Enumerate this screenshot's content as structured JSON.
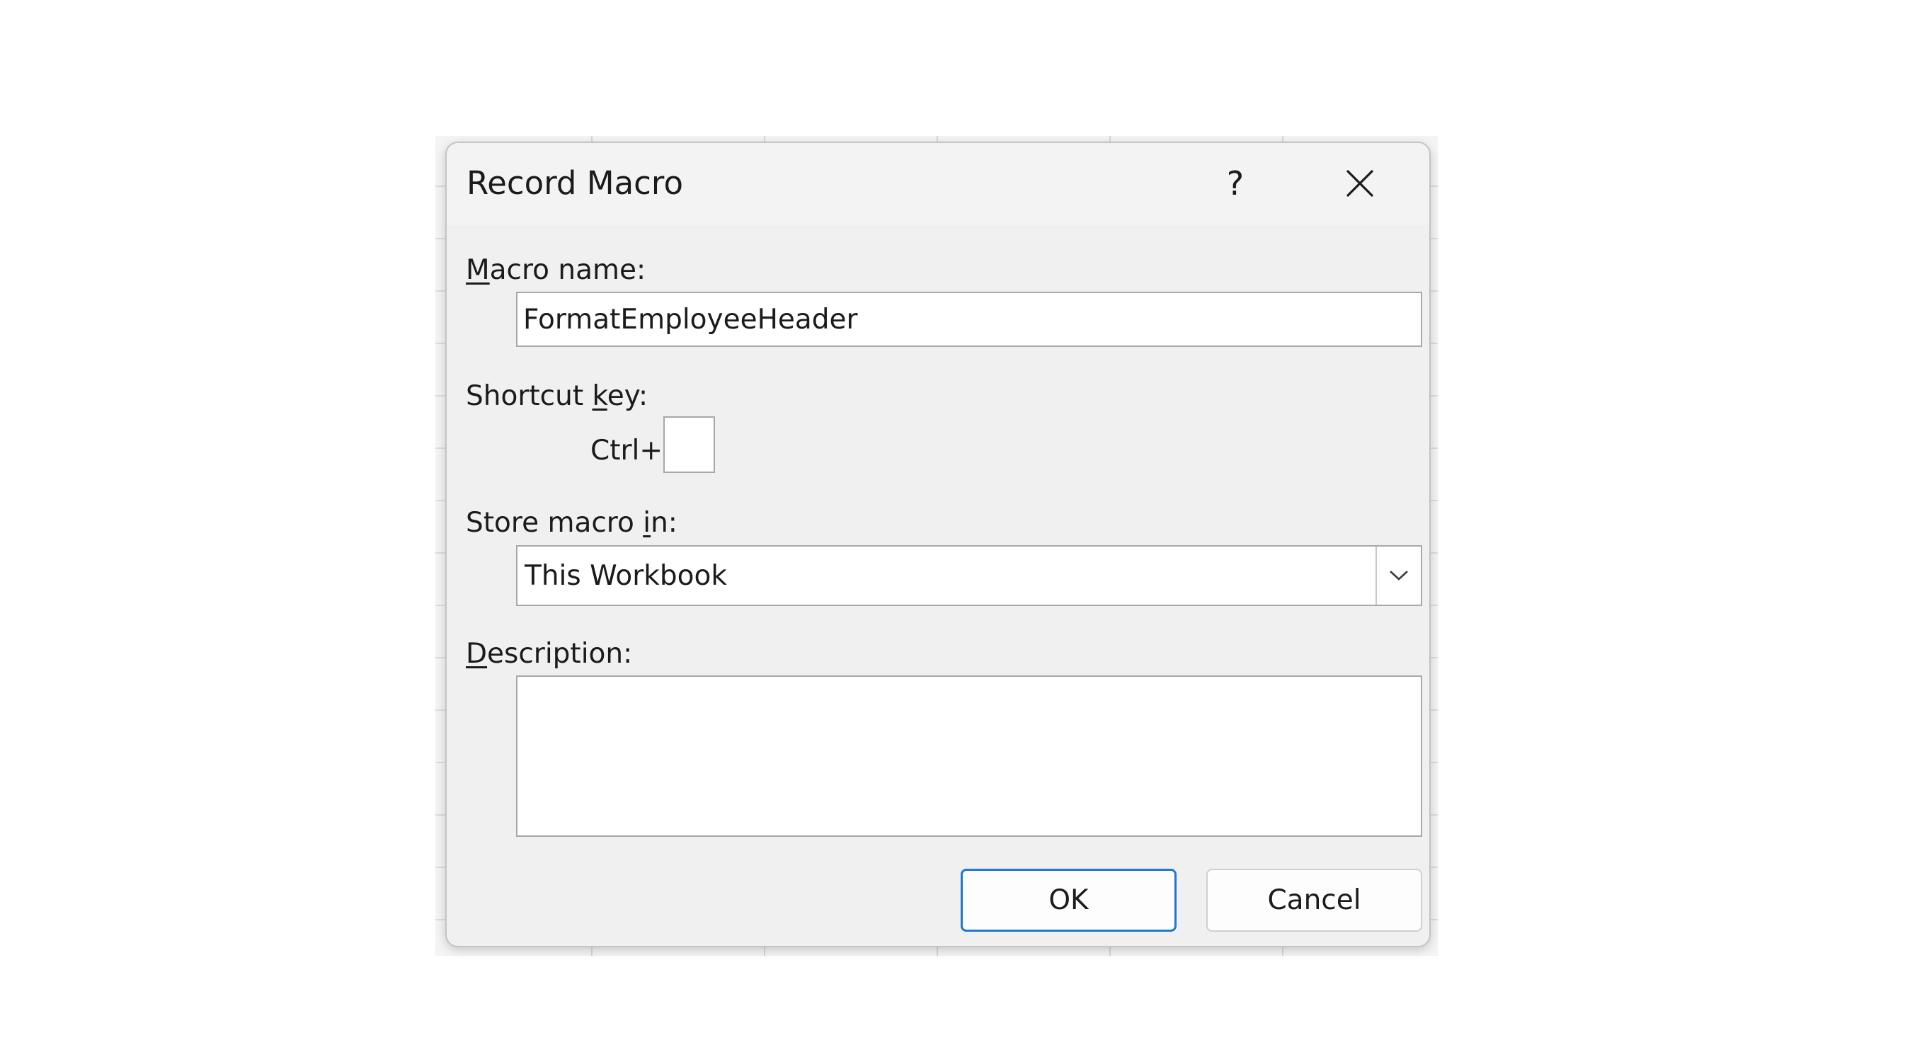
{
  "dialog": {
    "title": "Record Macro",
    "help_glyph": "?",
    "close_icon": "close-icon"
  },
  "macro_name": {
    "label_accel": "M",
    "label_rest": "acro name:",
    "value": "FormatEmployeeHeader"
  },
  "shortcut": {
    "label_pre": "Shortcut ",
    "label_accel": "k",
    "label_post": "ey:",
    "prefix": "Ctrl+",
    "value": ""
  },
  "store": {
    "label_pre": "Store macro ",
    "label_accel": "i",
    "label_post": "n:",
    "selected": "This Workbook",
    "arrow_icon": "chevron-down-icon"
  },
  "description": {
    "label_accel": "D",
    "label_rest": "escription:",
    "value": ""
  },
  "buttons": {
    "ok": "OK",
    "cancel": "Cancel"
  },
  "colors": {
    "dialog_bg": "#f0f0f0",
    "primary_border": "#1f78d1"
  }
}
